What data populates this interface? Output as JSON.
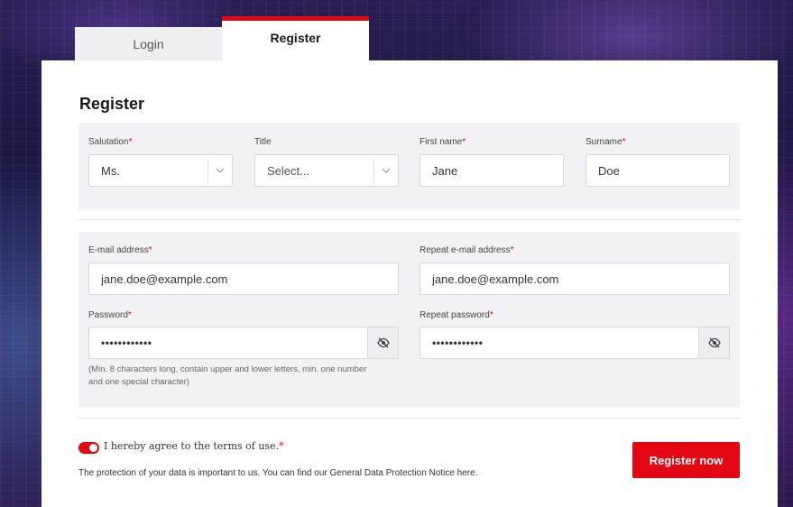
{
  "tabs": {
    "login": "Login",
    "register": "Register"
  },
  "form": {
    "heading": "Register",
    "salutation": {
      "label": "Salutation",
      "required": "*",
      "value": "Ms."
    },
    "title": {
      "label": "Title",
      "placeholder": "Select..."
    },
    "first_name": {
      "label": "First name",
      "required": "*",
      "value": "Jane"
    },
    "surname": {
      "label": "Surname",
      "required": "*",
      "value": "Doe"
    },
    "email": {
      "label": "E-mail address",
      "required": "*",
      "value": "jane.doe@example.com"
    },
    "repeat_email": {
      "label": "Repeat e-mail address",
      "required": "*",
      "value": "jane.doe@example.com"
    },
    "password": {
      "label": "Password",
      "required": "*",
      "value": "••••••••••••"
    },
    "repeat_password": {
      "label": "Repeat password",
      "required": "*",
      "value": "••••••••••••"
    },
    "password_hint_line1": "(Min. 8 characters long, contain upper and lower letters, min. one number",
    "password_hint_line2": "and one special character)"
  },
  "terms": {
    "text": "I hereby agree to the terms of use.",
    "required": "*",
    "checked": true
  },
  "privacy_text": "The protection of your data is important to us. You can find our General Data Protection Notice here.",
  "register_button": "Register now",
  "colors": {
    "accent": "#e30613",
    "panel": "#f2f2f4"
  },
  "icons": {
    "select_chevron": "chevron-down-icon",
    "password_toggle": "eye-slash-icon"
  }
}
